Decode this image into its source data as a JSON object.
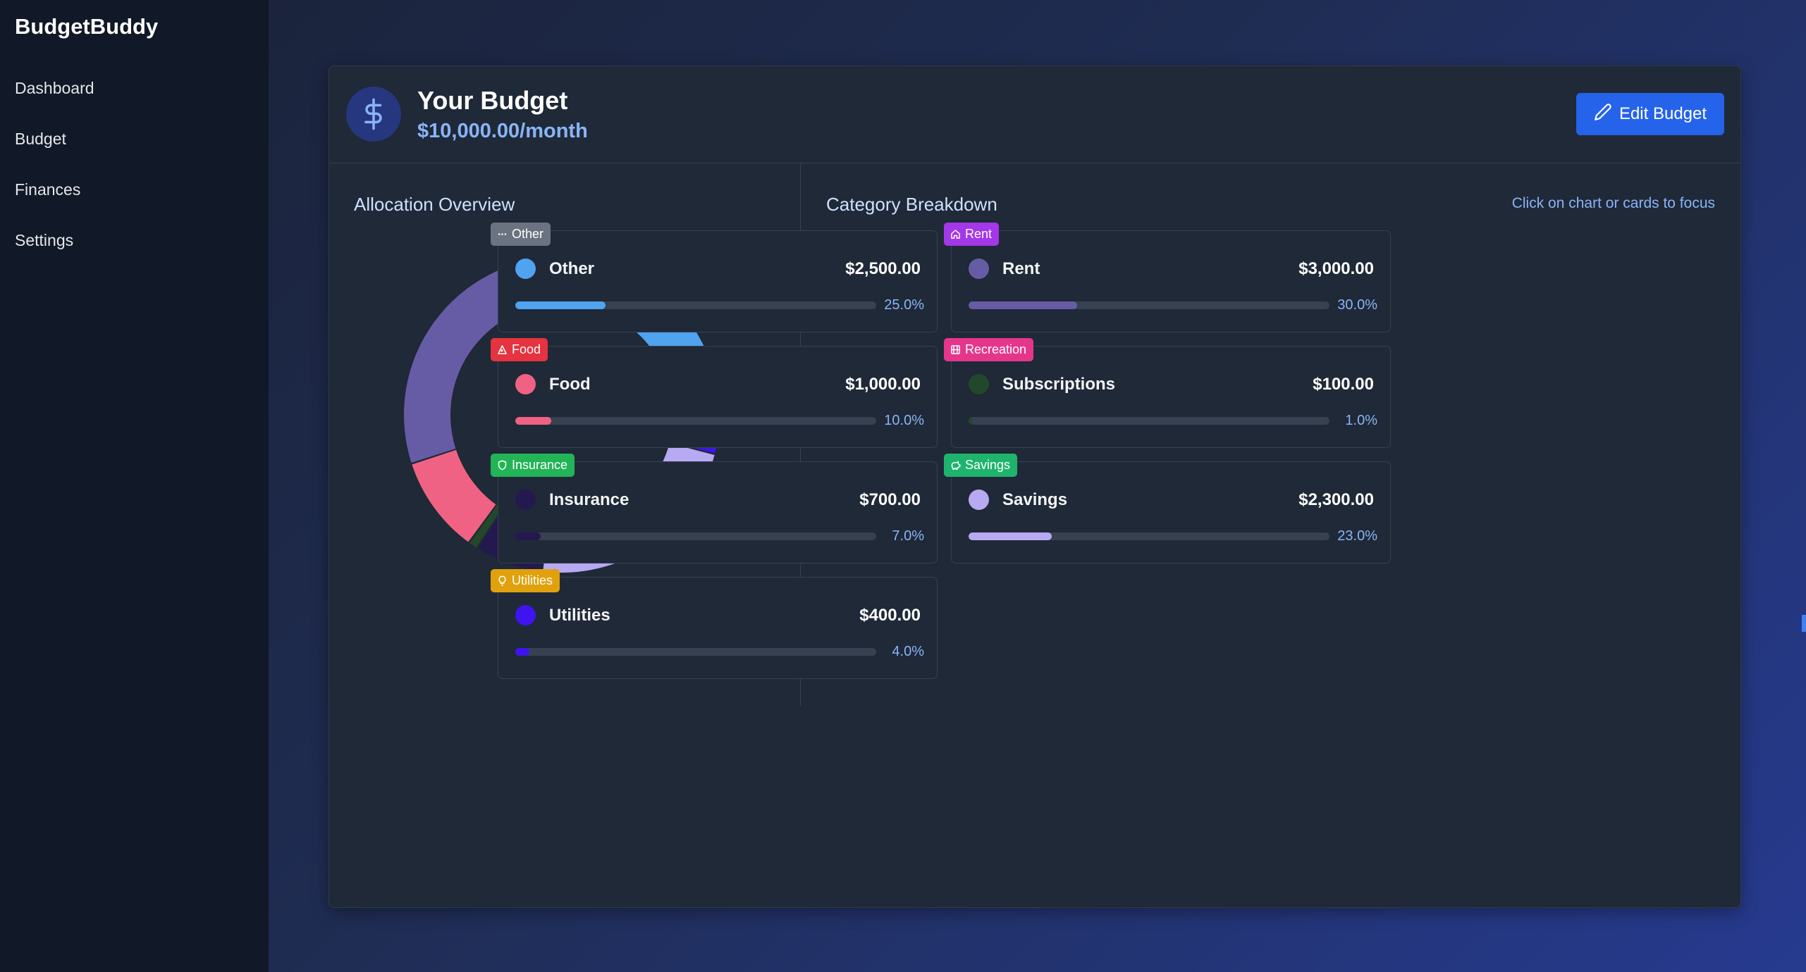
{
  "app": {
    "brand": "BudgetBuddy"
  },
  "sidebar": {
    "items": [
      {
        "label": "Dashboard"
      },
      {
        "label": "Budget"
      },
      {
        "label": "Finances"
      },
      {
        "label": "Settings"
      }
    ]
  },
  "header": {
    "title": "Your Budget",
    "amount": "$10,000.00/month",
    "edit_label": "Edit Budget",
    "icon": "dollar-icon"
  },
  "overview": {
    "title": "Allocation Overview"
  },
  "breakdown": {
    "title": "Category Breakdown",
    "hint": "Click on chart or cards to focus"
  },
  "chart_data": {
    "type": "pie",
    "variant": "donut",
    "slices": [
      {
        "label": "Other",
        "value": 2500,
        "color": "#4fa3ef"
      },
      {
        "label": "Utilities",
        "value": 400,
        "color": "#3f14f0"
      },
      {
        "label": "Savings",
        "value": 2300,
        "color": "#b8a9f3"
      },
      {
        "label": "Insurance",
        "value": 700,
        "color": "#24194f"
      },
      {
        "label": "Subscriptions",
        "value": 100,
        "color": "#23472a"
      },
      {
        "label": "Food",
        "value": 1000,
        "color": "#f06283"
      },
      {
        "label": "Rent",
        "value": 3000,
        "color": "#665ca6"
      }
    ]
  },
  "categories": [
    {
      "tag": "Other",
      "tag_color": "#6b7280",
      "tag_icon": "dots-icon",
      "name": "Other",
      "amount": "$2,500.00",
      "pct_label": "25.0%",
      "fraction": 0.25,
      "color": "#4fa3ef"
    },
    {
      "tag": "Rent",
      "tag_color": "#a437e8",
      "tag_icon": "home-icon",
      "name": "Rent",
      "amount": "$3,000.00",
      "pct_label": "30.0%",
      "fraction": 0.3,
      "color": "#665ca6"
    },
    {
      "tag": "Food",
      "tag_color": "#e5333f",
      "tag_icon": "pizza-icon",
      "name": "Food",
      "amount": "$1,000.00",
      "pct_label": "10.0%",
      "fraction": 0.1,
      "color": "#f06283"
    },
    {
      "tag": "Recreation",
      "tag_color": "#e5368b",
      "tag_icon": "film-icon",
      "name": "Subscriptions",
      "amount": "$100.00",
      "pct_label": "1.0%",
      "fraction": 0.01,
      "color": "#23472a"
    },
    {
      "tag": "Insurance",
      "tag_color": "#22b457",
      "tag_icon": "shield-icon",
      "name": "Insurance",
      "amount": "$700.00",
      "pct_label": "7.0%",
      "fraction": 0.07,
      "color": "#24194f"
    },
    {
      "tag": "Savings",
      "tag_color": "#1fb46e",
      "tag_icon": "piggy-bank-icon",
      "name": "Savings",
      "amount": "$2,300.00",
      "pct_label": "23.0%",
      "fraction": 0.23,
      "color": "#b8a9f3"
    },
    {
      "tag": "Utilities",
      "tag_color": "#e0a10c",
      "tag_icon": "lightbulb-icon",
      "name": "Utilities",
      "amount": "$400.00",
      "pct_label": "4.0%",
      "fraction": 0.04,
      "color": "#3f14f0"
    }
  ]
}
